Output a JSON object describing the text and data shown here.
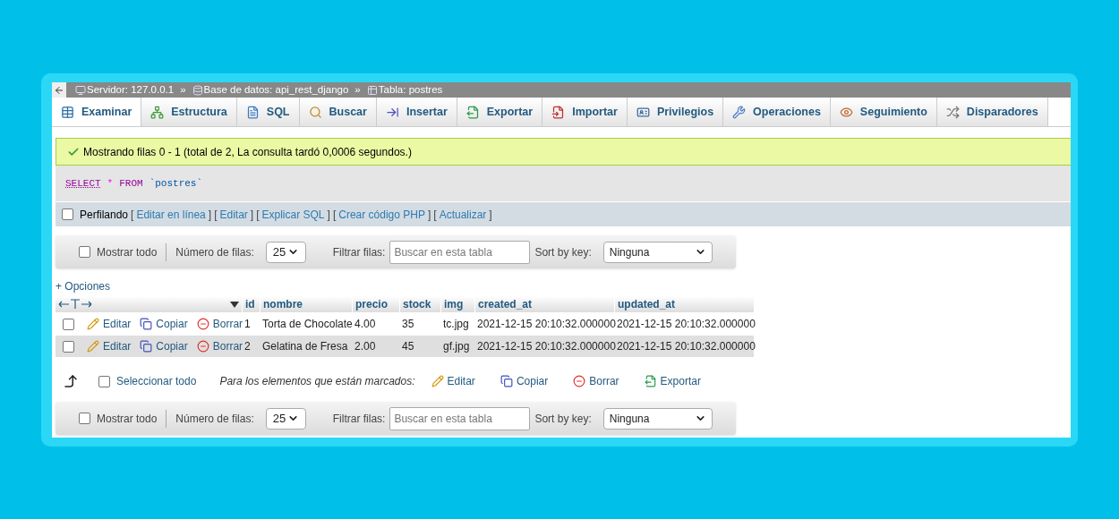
{
  "breadcrumb": {
    "items": [
      {
        "kind": "server",
        "label": "Servidor: 127.0.0.1"
      },
      {
        "kind": "database",
        "label": "Base de datos: api_rest_django"
      },
      {
        "kind": "table",
        "label": "Tabla: postres"
      }
    ],
    "separator": "»"
  },
  "tabs": [
    {
      "kind": "browse",
      "label": "Examinar",
      "selected": true
    },
    {
      "kind": "structure",
      "label": "Estructura",
      "selected": false
    },
    {
      "kind": "sql",
      "label": "SQL",
      "selected": false
    },
    {
      "kind": "search",
      "label": "Buscar",
      "selected": false
    },
    {
      "kind": "insert",
      "label": "Insertar",
      "selected": false
    },
    {
      "kind": "export",
      "label": "Exportar",
      "selected": false
    },
    {
      "kind": "import",
      "label": "Importar",
      "selected": false
    },
    {
      "kind": "privileges",
      "label": "Privilegios",
      "selected": false
    },
    {
      "kind": "operations",
      "label": "Operaciones",
      "selected": false
    },
    {
      "kind": "tracking",
      "label": "Seguimiento",
      "selected": false
    },
    {
      "kind": "triggers",
      "label": "Disparadores",
      "selected": false
    }
  ],
  "message": "Mostrando filas 0 - 1 (total de 2, La consulta tardó 0,0006 segundos.)",
  "sql": [
    {
      "kind": "keyword",
      "text": "SELECT"
    },
    {
      "kind": "operator",
      "text": "*"
    },
    {
      "kind": "keyword",
      "text": "FROM"
    },
    {
      "kind": "identifier",
      "text": "`postres`"
    }
  ],
  "profiling": {
    "label": "Perfilando",
    "checked": false,
    "bracket_open": "[",
    "bracket_close": "]",
    "links": [
      "Editar en línea",
      "Editar",
      "Explicar SQL",
      "Crear código PHP",
      "Actualizar"
    ]
  },
  "nav_bars": [
    {
      "show_all": "Mostrar todo",
      "show_all_checked": false,
      "rows_label": "Número de filas:",
      "rows_value": "25",
      "filter_label": "Filtrar filas:",
      "filter_placeholder": "Buscar en esta tabla",
      "sort_label": "Sort by key:",
      "sort_value": "Ninguna"
    },
    {
      "show_all": "Mostrar todo",
      "show_all_checked": false,
      "rows_label": "Número de filas:",
      "rows_value": "25",
      "filter_label": "Filtrar filas:",
      "filter_placeholder": "Buscar en esta tabla",
      "sort_label": "Sort by key:",
      "sort_value": "Ninguna"
    }
  ],
  "options_link": "+ Opciones",
  "table": {
    "columns": [
      "id",
      "nombre",
      "precio",
      "stock",
      "img",
      "created_at",
      "updated_at"
    ],
    "rows": [
      {
        "checked": false,
        "actions": [
          {
            "kind": "edit",
            "label": "Editar"
          },
          {
            "kind": "copy",
            "label": "Copiar"
          },
          {
            "kind": "delete",
            "label": "Borrar"
          }
        ],
        "cells": [
          "1",
          "Torta de Chocolate",
          "4.00",
          "35",
          "tc.jpg",
          "2021-12-15 20:10:32.000000",
          "2021-12-15 20:10:32.000000"
        ]
      },
      {
        "checked": false,
        "actions": [
          {
            "kind": "edit",
            "label": "Editar"
          },
          {
            "kind": "copy",
            "label": "Copiar"
          },
          {
            "kind": "delete",
            "label": "Borrar"
          }
        ],
        "cells": [
          "2",
          "Gelatina de Fresa",
          "2.00",
          "45",
          "gf.jpg",
          "2021-12-15 20:10:32.000000",
          "2021-12-15 20:10:32.000000"
        ]
      }
    ]
  },
  "bulk": {
    "select_all": "Seleccionar todo",
    "select_all_checked": false,
    "prompt": "Para los elementos que están marcados:",
    "actions": [
      {
        "kind": "edit",
        "label": "Editar"
      },
      {
        "kind": "copy",
        "label": "Copiar"
      },
      {
        "kind": "delete",
        "label": "Borrar"
      },
      {
        "kind": "export",
        "label": "Exportar"
      }
    ]
  }
}
